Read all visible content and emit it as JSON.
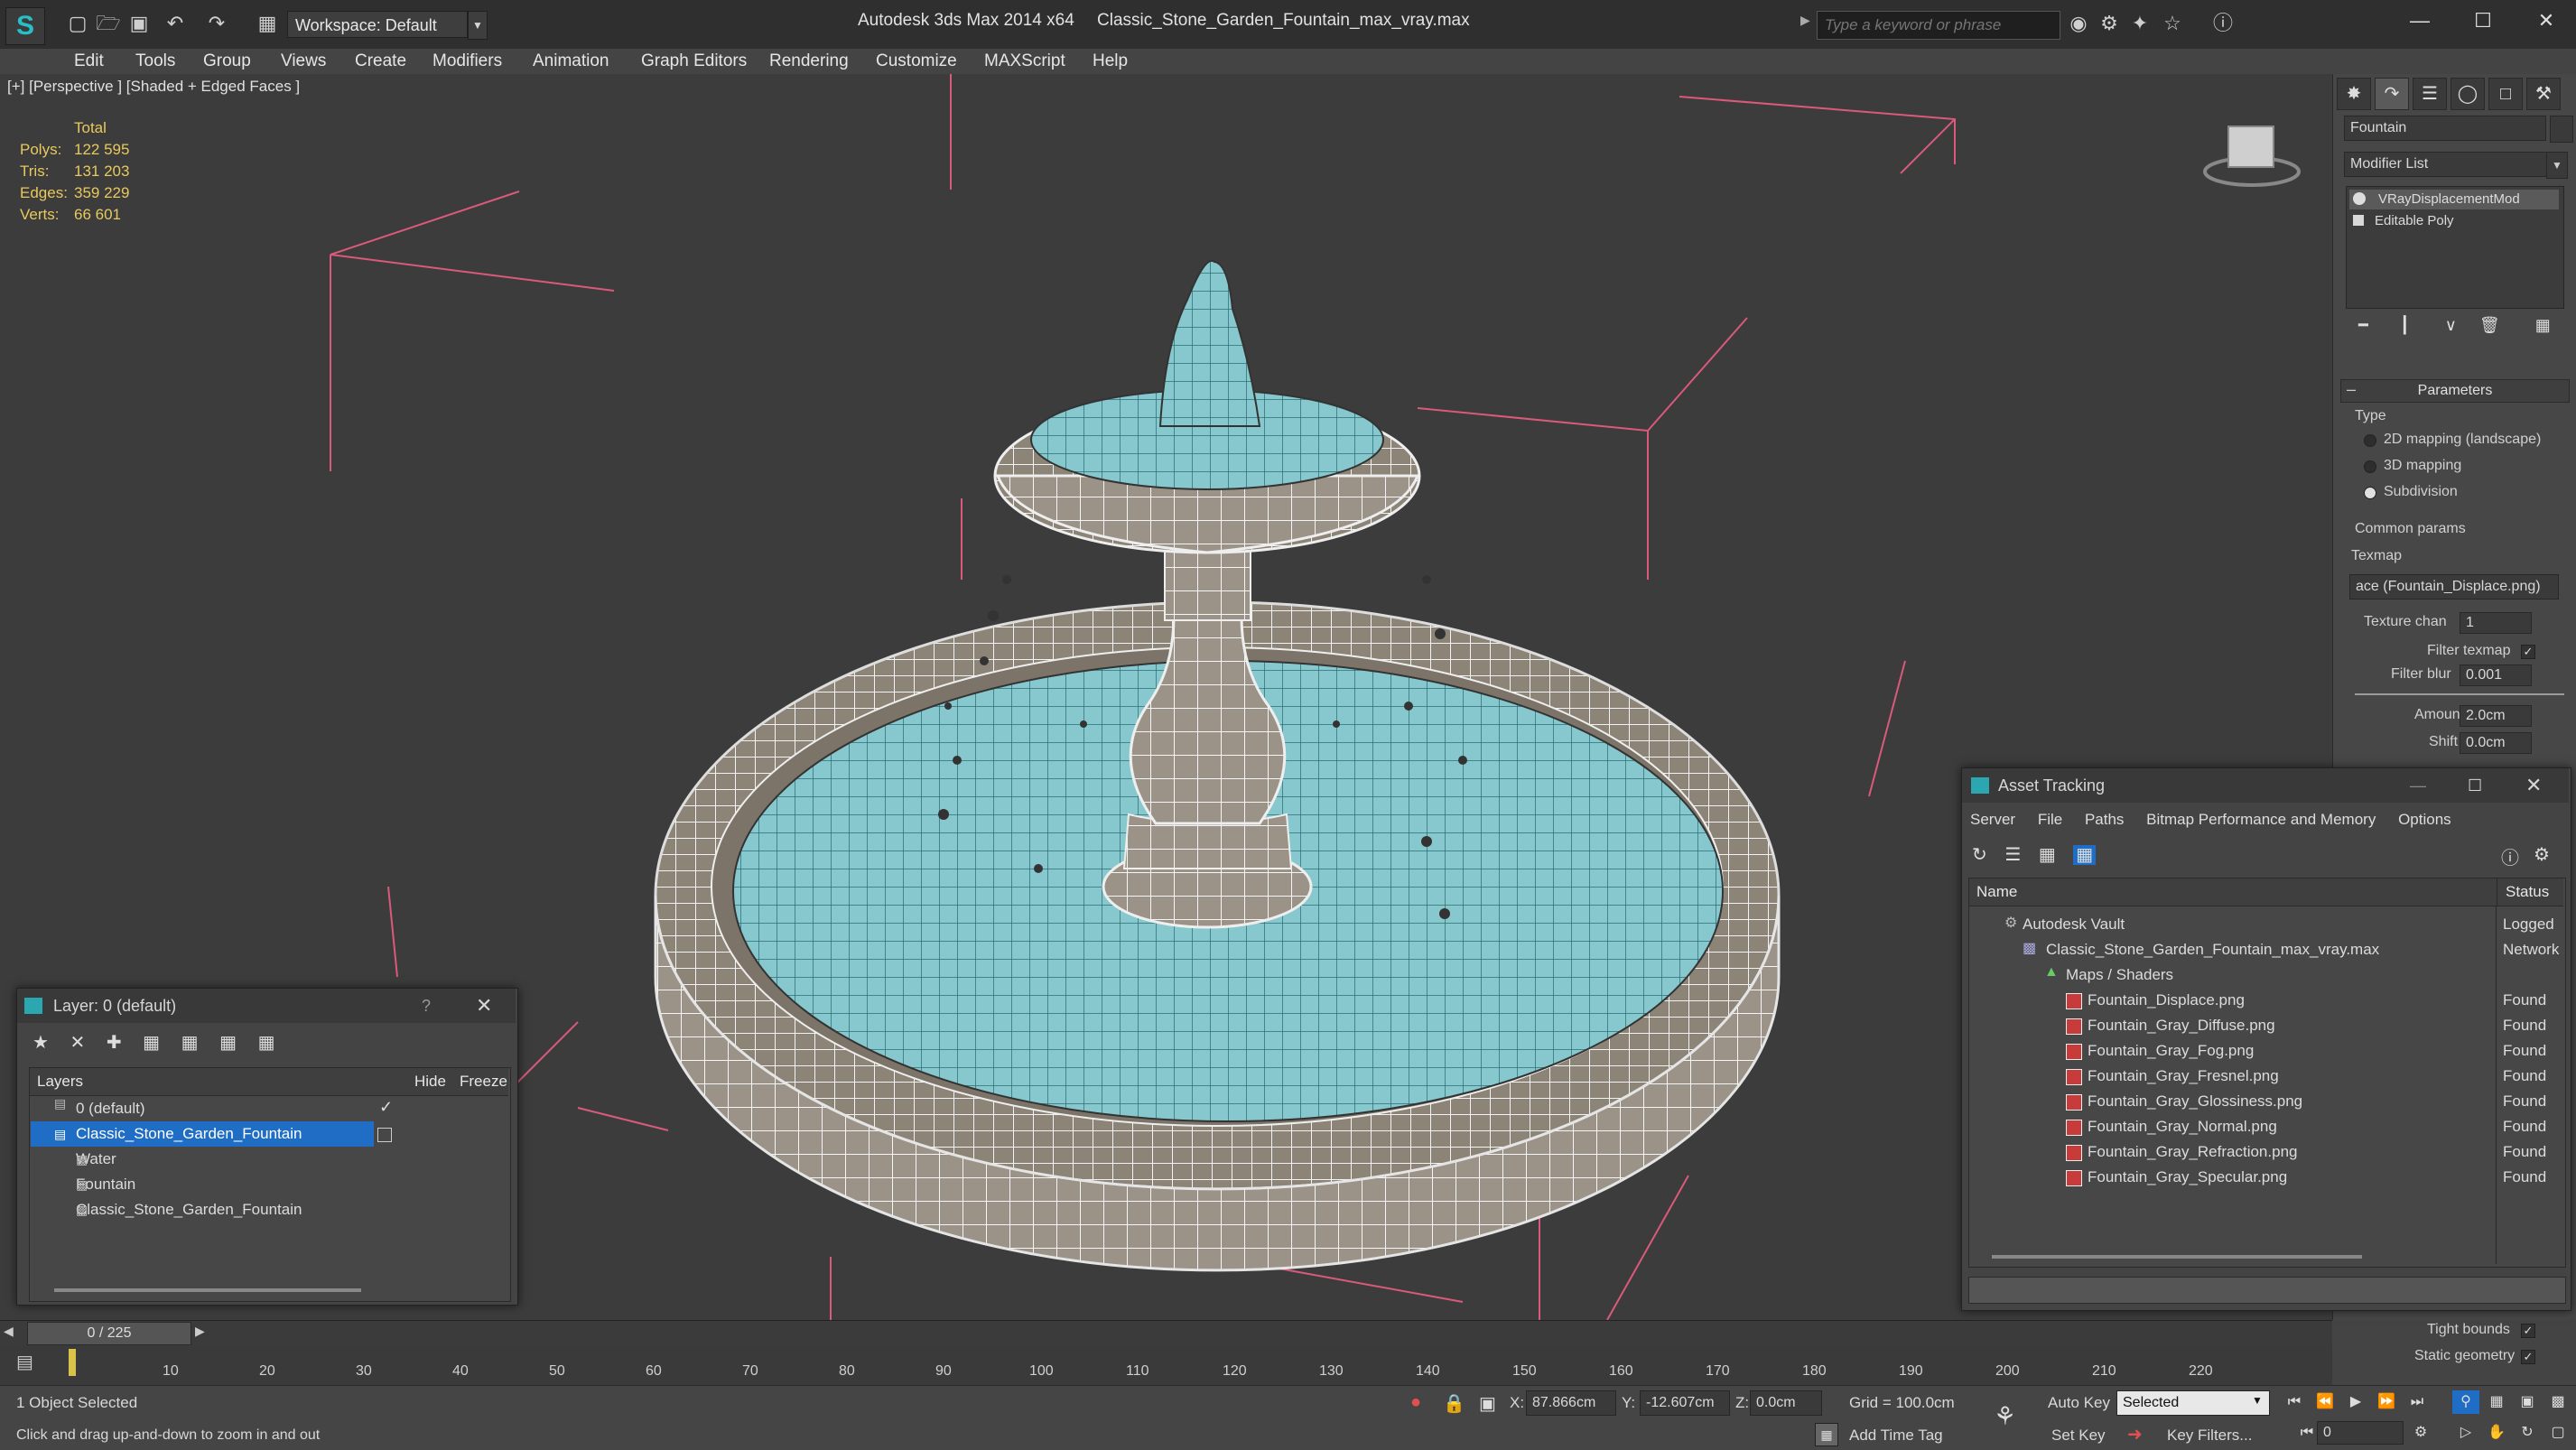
{
  "titlebar": {
    "workspace_label": "Workspace: Default",
    "app_name": "Autodesk 3ds Max  2014 x64",
    "file_name": "Classic_Stone_Garden_Fountain_max_vray.max",
    "search_placeholder": "Type a keyword or phrase"
  },
  "menu": [
    "Edit",
    "Tools",
    "Group",
    "Views",
    "Create",
    "Modifiers",
    "Animation",
    "Graph Editors",
    "Rendering",
    "Customize",
    "MAXScript",
    "Help"
  ],
  "viewport": {
    "label": "[+] [Perspective ] [Shaded + Edged Faces ]",
    "stats": {
      "total_label": "Total",
      "rows": [
        {
          "label": "Polys:",
          "value": "122 595"
        },
        {
          "label": "Tris:",
          "value": "131 203"
        },
        {
          "label": "Edges:",
          "value": "359 229"
        },
        {
          "label": "Verts:",
          "value": "66 601"
        }
      ]
    }
  },
  "command_panel": {
    "object_name": "Fountain",
    "modifier_list": "Modifier List",
    "stack": [
      "VRayDisplacementMod",
      "Editable Poly"
    ],
    "parameters_title": "Parameters",
    "type_label": "Type",
    "type_options": [
      {
        "label": "2D mapping (landscape)",
        "selected": false
      },
      {
        "label": "3D mapping",
        "selected": false
      },
      {
        "label": "Subdivision",
        "selected": true
      }
    ],
    "common_params": "Common params",
    "texmap_label": "Texmap",
    "texmap_value": "ace (Fountain_Displace.png)",
    "texture_chan_label": "Texture chan",
    "texture_chan_value": "1",
    "filter_texmap_label": "Filter texmap",
    "filter_blur_label": "Filter blur",
    "filter_blur_value": "0.001",
    "amount_label": "Amount",
    "amount_value": "2.0cm",
    "shift_label": "Shift",
    "shift_value": "0.0cm",
    "tight_bounds": "Tight bounds",
    "static_geometry": "Static geometry"
  },
  "layer_window": {
    "title": "Layer: 0 (default)",
    "help": "?",
    "col_layers": "Layers",
    "col_hide": "Hide",
    "col_freeze": "Freeze",
    "rows": [
      {
        "name": "0 (default)",
        "selected": false
      },
      {
        "name": "Classic_Stone_Garden_Fountain",
        "selected": true
      },
      {
        "name": "Water",
        "selected": false
      },
      {
        "name": "Fountain",
        "selected": false
      },
      {
        "name": "Classic_Stone_Garden_Fountain",
        "selected": false
      }
    ]
  },
  "asset_window": {
    "title": "Asset Tracking",
    "menu": [
      "Server",
      "File",
      "Paths",
      "Bitmap Performance and Memory",
      "Options"
    ],
    "col_name": "Name",
    "col_status": "Status",
    "rows": [
      {
        "name": "Autodesk Vault",
        "status": "Logged"
      },
      {
        "name": "Classic_Stone_Garden_Fountain_max_vray.max",
        "status": "Network"
      },
      {
        "name": "Maps / Shaders",
        "status": ""
      },
      {
        "name": "Fountain_Displace.png",
        "status": "Found"
      },
      {
        "name": "Fountain_Gray_Diffuse.png",
        "status": "Found"
      },
      {
        "name": "Fountain_Gray_Fog.png",
        "status": "Found"
      },
      {
        "name": "Fountain_Gray_Fresnel.png",
        "status": "Found"
      },
      {
        "name": "Fountain_Gray_Glossiness.png",
        "status": "Found"
      },
      {
        "name": "Fountain_Gray_Normal.png",
        "status": "Found"
      },
      {
        "name": "Fountain_Gray_Refraction.png",
        "status": "Found"
      },
      {
        "name": "Fountain_Gray_Specular.png",
        "status": "Found"
      }
    ]
  },
  "timeline": {
    "frame": "0 / 225",
    "ticks": [
      "10",
      "20",
      "30",
      "40",
      "50",
      "60",
      "70",
      "80",
      "90",
      "100",
      "110",
      "120",
      "130",
      "140",
      "150",
      "160",
      "170",
      "180",
      "190",
      "200",
      "210",
      "220"
    ]
  },
  "status": {
    "selection": "1 Object Selected",
    "hint": "Click and drag up-and-down to zoom in and out",
    "x_label": "X:",
    "x_value": "87.866cm",
    "y_label": "Y:",
    "y_value": "-12.607cm",
    "z_label": "Z:",
    "z_value": "0.0cm",
    "grid": "Grid = 100.0cm",
    "add_time_tag": "Add Time Tag",
    "auto_key": "Auto Key",
    "set_key": "Set Key",
    "selected_dropdown": "Selected",
    "key_filters": "Key Filters...",
    "frame_field": "0"
  },
  "colors": {
    "accent": "#1f6dc4",
    "water": "#7fc6cc",
    "grid_pink": "#d95a7a",
    "stats": "#e8c95d"
  }
}
